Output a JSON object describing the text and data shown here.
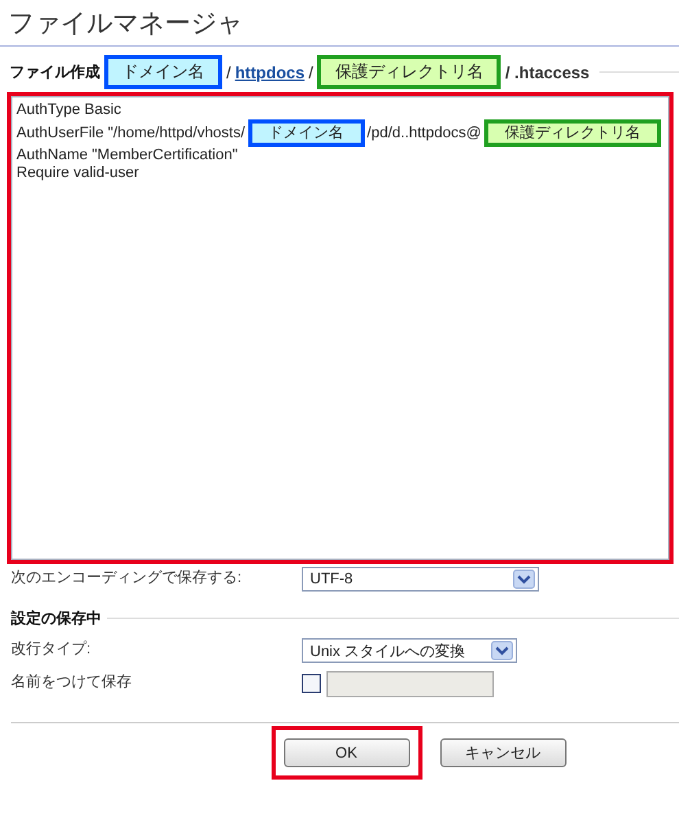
{
  "title": "ファイルマネージャ",
  "path": {
    "label": "ファイル作成",
    "parts": [
      {
        "kind": "annotation",
        "text": "ドメイン名",
        "color": "#0050ff"
      },
      {
        "kind": "separator",
        "text": "/"
      },
      {
        "kind": "link",
        "text": "httpdocs"
      },
      {
        "kind": "separator",
        "text": "/"
      },
      {
        "kind": "annotation",
        "text": "保護ディレクトリ名",
        "color": "#20a020"
      },
      {
        "kind": "filename",
        "text": "/ .htaccess"
      }
    ]
  },
  "editor": {
    "highlighted": true,
    "lines": [
      [
        {
          "kind": "code",
          "text": "AuthType Basic"
        }
      ],
      [
        {
          "kind": "code",
          "text": "AuthUserFile \"/home/httpd/vhosts/"
        },
        {
          "kind": "annotation",
          "text": "ドメイン名",
          "color": "#0050ff"
        },
        {
          "kind": "code",
          "text": "/pd/d..httpdocs@"
        },
        {
          "kind": "annotation",
          "text": "保護ディレクトリ名",
          "color": "#20a020"
        }
      ],
      [
        {
          "kind": "code",
          "text": "AuthName \"MemberCertification\""
        }
      ],
      [
        {
          "kind": "code",
          "text": "Require valid-user"
        }
      ]
    ]
  },
  "encoding": {
    "label": "次のエンコーディングで保存する:",
    "value": "UTF-8"
  },
  "section": "設定の保存中",
  "line_type": {
    "label": "改行タイプ:",
    "value": "Unix スタイルへの変換"
  },
  "save_as": {
    "label": "名前をつけて保存",
    "checked": false,
    "disabled": true
  },
  "buttons": [
    {
      "label": "OK",
      "highlighted": true
    },
    {
      "label": "キャンセル",
      "highlighted": false
    }
  ]
}
